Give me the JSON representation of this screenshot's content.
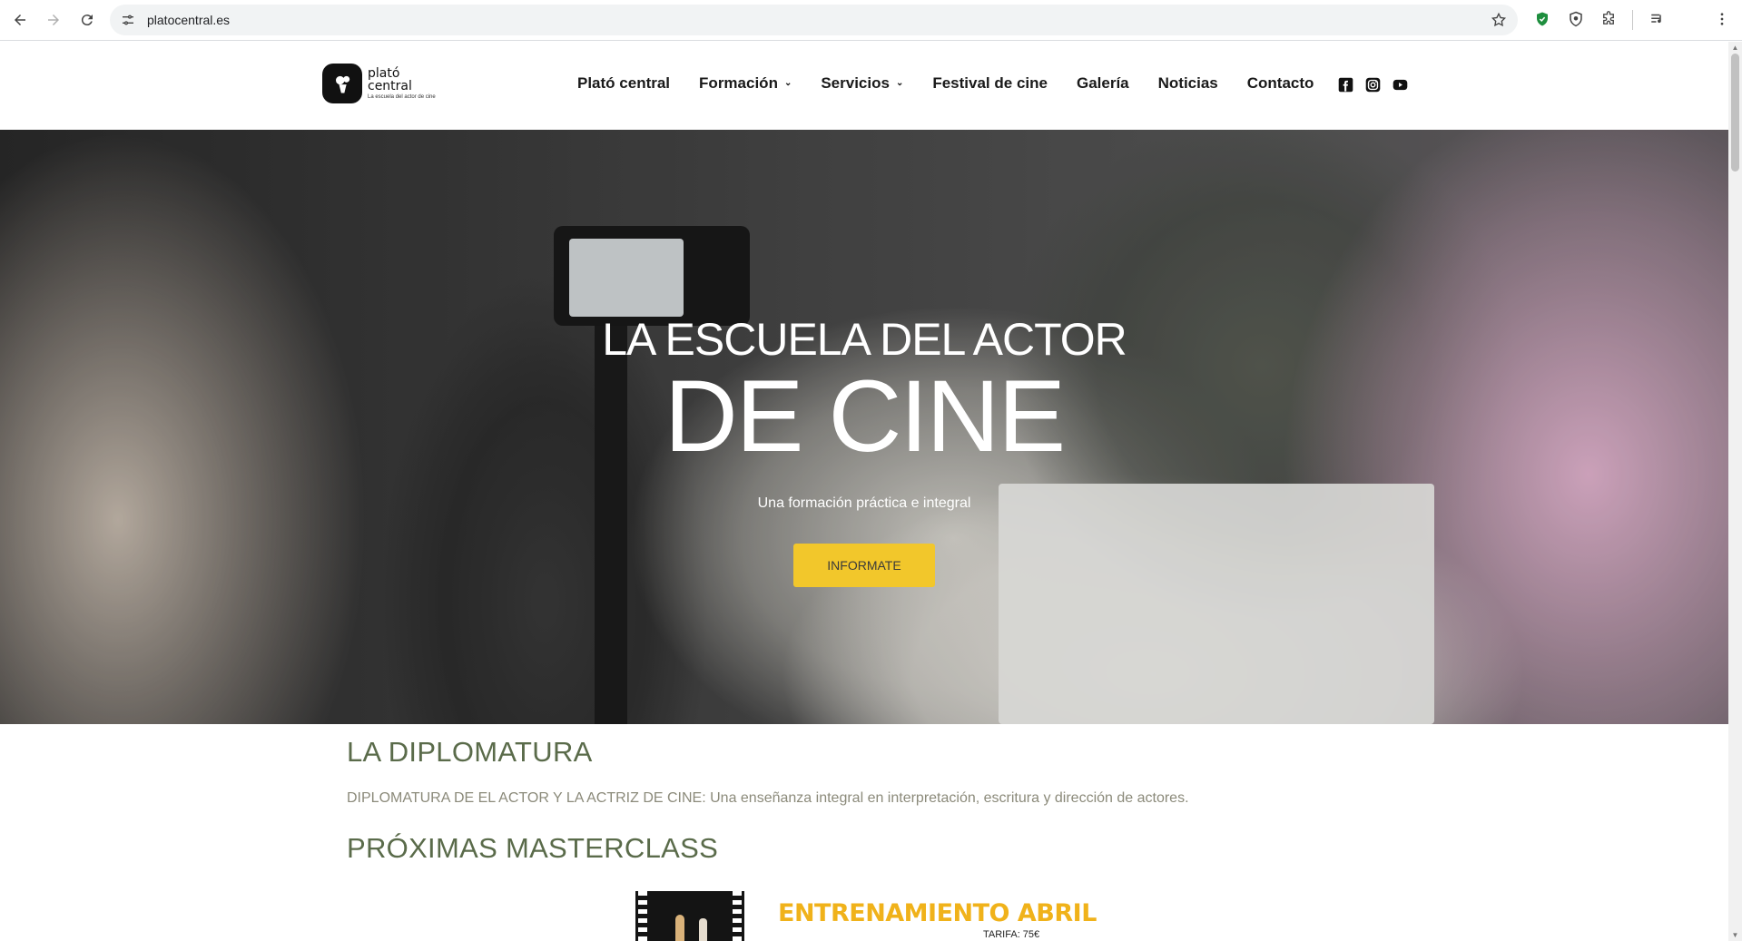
{
  "browser": {
    "url": "platocentral.es",
    "back_icon": "arrow-left",
    "forward_icon": "arrow-right",
    "reload_icon": "reload",
    "site_info_icon": "tune",
    "bookmark_icon": "star",
    "extensions": [
      "shield-green",
      "shield-outline",
      "puzzle"
    ],
    "media_icon": "queue-music",
    "menu_icon": "vertical-dots"
  },
  "site": {
    "logo": {
      "line1": "plató",
      "line2": "central",
      "tagline": "La escuela del actor de cine"
    },
    "nav": [
      {
        "label": "Plató central",
        "dropdown": false
      },
      {
        "label": "Formación",
        "dropdown": true
      },
      {
        "label": "Servicios",
        "dropdown": true
      },
      {
        "label": "Festival de cine",
        "dropdown": false
      },
      {
        "label": "Galería",
        "dropdown": false
      },
      {
        "label": "Noticias",
        "dropdown": false
      },
      {
        "label": "Contacto",
        "dropdown": false
      }
    ],
    "social": [
      "facebook",
      "instagram",
      "youtube"
    ]
  },
  "hero": {
    "line1": "LA ESCUELA DEL ACTOR",
    "line2": "DE CINE",
    "subtitle": "Una formación práctica e integral",
    "button": "INFORMATE",
    "button_color": "#f2c72b"
  },
  "content": {
    "diplomatura_title": "LA DIPLOMATURA",
    "diplomatura_text": "DIPLOMATURA DE EL ACTOR Y LA ACTRIZ DE CINE: Una enseñanza integral en interpretación, escritura y dirección de actores.",
    "masterclass_title": "PRÓXIMAS MASTERCLASS",
    "poster_title": "ENTRENAMIENTO ABRIL",
    "poster_price": "TARIFA: 75€",
    "heading_color": "#5a6b4a",
    "accent": "#f0b21a"
  }
}
